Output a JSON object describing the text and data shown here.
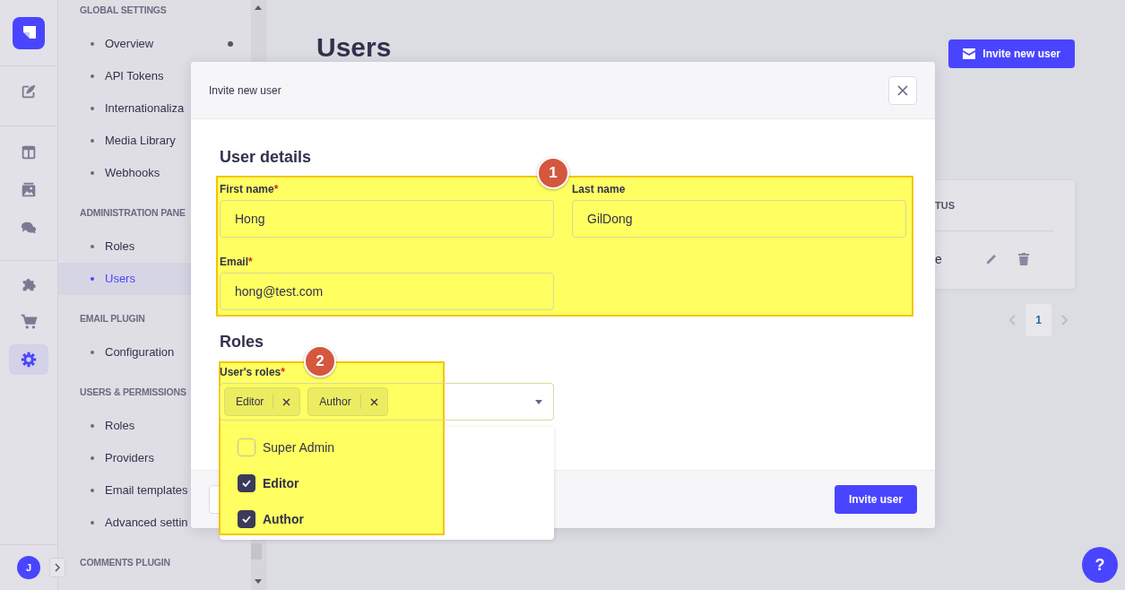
{
  "rail": {
    "items": [
      {
        "selected": false
      },
      {
        "selected": false
      },
      {
        "selected": false
      },
      {
        "selected": false
      },
      {
        "selected": false
      },
      {
        "selected": false
      },
      {
        "selected": true
      }
    ],
    "avatar": "J"
  },
  "subnav": {
    "sections": [
      {
        "title": "GLOBAL SETTINGS",
        "items": [
          {
            "label": "Overview",
            "selected": false,
            "dot": true
          },
          {
            "label": "API Tokens",
            "selected": false
          },
          {
            "label": "Internationaliza",
            "selected": false
          },
          {
            "label": "Media Library",
            "selected": false
          },
          {
            "label": "Webhooks",
            "selected": false
          }
        ]
      },
      {
        "title": "ADMINISTRATION PANE",
        "items": [
          {
            "label": "Roles",
            "selected": false
          },
          {
            "label": "Users",
            "selected": true
          }
        ]
      },
      {
        "title": "EMAIL PLUGIN",
        "items": [
          {
            "label": "Configuration",
            "selected": false
          }
        ]
      },
      {
        "title": "USERS & PERMISSIONS",
        "items": [
          {
            "label": "Roles",
            "selected": false
          },
          {
            "label": "Providers",
            "selected": false
          },
          {
            "label": "Email templates",
            "selected": false
          },
          {
            "label": "Advanced settin",
            "selected": false
          }
        ]
      },
      {
        "title": "COMMENTS PLUGIN"
      }
    ]
  },
  "page": {
    "title": "Users",
    "invite_button": "Invite new user",
    "table": {
      "column": "TUS",
      "cell": "e"
    },
    "pagination": [
      {
        "label": "1",
        "selected": true
      }
    ]
  },
  "help_button": "?",
  "modal": {
    "title": "Invite new user",
    "user_details": {
      "heading": "User details",
      "fields": [
        {
          "label": "First name",
          "required_mark": "*",
          "value": "Hong"
        },
        {
          "label": "Last name",
          "value": "GilDong"
        },
        {
          "label": "Email",
          "required_mark": "*",
          "value": "hong@test.com"
        }
      ]
    },
    "roles": {
      "heading": "Roles",
      "label": "User's roles",
      "required_mark": "*",
      "chips": [
        "Editor",
        "Author"
      ],
      "options": [
        {
          "label": "Super Admin",
          "checked": false
        },
        {
          "label": "Editor",
          "checked": true
        },
        {
          "label": "Author",
          "checked": true
        }
      ]
    },
    "footer": {
      "submit": "Invite user"
    }
  },
  "annotations": [
    {
      "number": "1"
    },
    {
      "number": "2"
    }
  ]
}
